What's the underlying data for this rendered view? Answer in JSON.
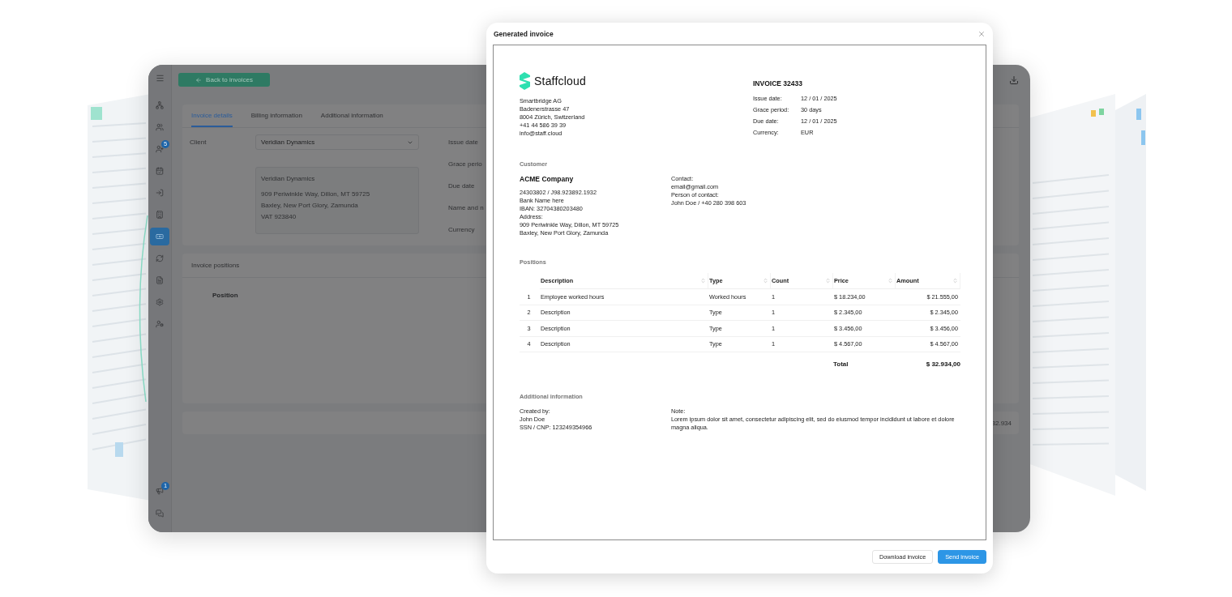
{
  "background_app": {
    "back_button": "Back to invoices",
    "sidebar_items": [
      {
        "selected": false
      },
      {
        "selected": false
      },
      {
        "selected": false,
        "badge": "5"
      },
      {
        "selected": false
      },
      {
        "selected": false
      },
      {
        "selected": false
      },
      {
        "selected": true
      },
      {
        "selected": false
      },
      {
        "selected": false
      },
      {
        "selected": false
      },
      {
        "selected": false
      }
    ],
    "sidebar_bottom": [
      {
        "badge": "1",
        "selected": false
      },
      {
        "selected": false
      }
    ],
    "tabs": [
      {
        "label": "Invoice details",
        "selected": true
      },
      {
        "label": "Billing information",
        "selected": false
      },
      {
        "label": "Additional information",
        "selected": false
      }
    ],
    "client": {
      "label": "Client",
      "value": "Veridian Dynamics"
    },
    "client_address": [
      "Veridian Dynamics",
      "909 Periwinkle Way, Dillon, MT 59725",
      "Baxley, New Port Glory, Zamunda",
      "VAT 923840"
    ],
    "field_labels": [
      "Issue date",
      "Grace perio",
      "Due date",
      "Name and n",
      "Currency"
    ],
    "positions": {
      "title": "Invoice positions",
      "column": "Position"
    },
    "total": "32.934"
  },
  "dialog": {
    "title": "Generated invoice",
    "company": {
      "logo_text": "Staffcloud",
      "lines": [
        "Smartbridge AG",
        "Badenerstrasse 47",
        "8004 Zürich, Switzerland",
        "+41 44 586 39 39",
        "info@staff.cloud"
      ]
    },
    "invoice": {
      "title": "INVOICE 32433",
      "details": [
        {
          "label": "Issue date:",
          "value": "12 / 01 / 2025"
        },
        {
          "label": "Grace period:",
          "value": "30 days"
        },
        {
          "label": "Due date:",
          "value": "12 / 01 / 2025"
        },
        {
          "label": "Currency:",
          "value": "EUR"
        }
      ]
    },
    "customer": {
      "heading": "Customer",
      "name": "ACME Company",
      "lines": [
        "24303802 / J98.923892.1932",
        "Bank Name here",
        "IBAN: 32704380203480",
        "Address:",
        "909 Periwinkle Way, Dillon, MT 59725",
        "Baxley, New Port Glory, Zamunda"
      ],
      "contact_lines": [
        "Contact:",
        "email@gmail.com",
        "Person of contact:",
        "John Doe / +40 280 398 603"
      ]
    },
    "positions": {
      "heading": "Positions",
      "columns": [
        "Description",
        "Type",
        "Count",
        "Price",
        "Amount"
      ],
      "rows": [
        {
          "index": "1",
          "description": "Employee worked hours",
          "type": "Worked hours",
          "count": "1",
          "price": "$ 18.234,00",
          "amount": "$ 21.555,00"
        },
        {
          "index": "2",
          "description": "Description",
          "type": "Type",
          "count": "1",
          "price": "$ 2.345,00",
          "amount": "$ 2.345,00"
        },
        {
          "index": "3",
          "description": "Description",
          "type": "Type",
          "count": "1",
          "price": "$ 3.456,00",
          "amount": "$ 3.456,00"
        },
        {
          "index": "4",
          "description": "Description",
          "type": "Type",
          "count": "1",
          "price": "$ 4.567,00",
          "amount": "$ 4.567,00"
        }
      ],
      "total_label": "Total",
      "total": "$ 32.934,00"
    },
    "additional": {
      "heading": "Additional information",
      "created_lines": [
        "Created by:",
        "John Doe",
        "SSN / CNP: 123249354966"
      ],
      "note_label": "Note:",
      "note": "Lorem ipsum dolor sit amet, consectetur adipiscing elit, sed do eiusmod tempor incididunt ut labore et dolore magna aliqua."
    },
    "buttons": [
      {
        "label": "Download invoice",
        "kind": "secondary"
      },
      {
        "label": "Send invoice",
        "kind": "primary"
      }
    ]
  }
}
